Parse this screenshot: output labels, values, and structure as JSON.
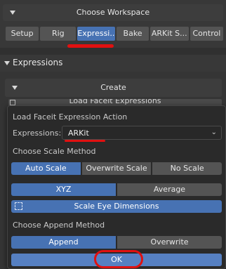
{
  "workspace": {
    "title": "Choose Workspace",
    "tabs": [
      {
        "label": "Setup",
        "active": false
      },
      {
        "label": "Rig",
        "active": false
      },
      {
        "label": "Expressi...",
        "active": true
      },
      {
        "label": "Bake",
        "active": false
      },
      {
        "label": "ARKit S...",
        "active": false
      },
      {
        "label": "Control",
        "active": false
      }
    ]
  },
  "expressions_panel": {
    "title": "Expressions",
    "create_title": "Create",
    "behind_button": "Load Faceit Expressions"
  },
  "popup": {
    "title": "Load Faceit Expression Action",
    "expressions_label": "Expressions:",
    "expressions_value": "ARKit",
    "scale_method_label": "Choose Scale Method",
    "scale_options": [
      {
        "label": "Auto Scale",
        "selected": true
      },
      {
        "label": "Overwrite Scale",
        "selected": false
      },
      {
        "label": "No Scale",
        "selected": false
      }
    ],
    "axis_options": [
      {
        "label": "XYZ",
        "selected": true
      },
      {
        "label": "Average",
        "selected": false
      }
    ],
    "scale_eye_button": "Scale Eye Dimensions",
    "append_method_label": "Choose Append Method",
    "append_options": [
      {
        "label": "Append",
        "selected": true
      },
      {
        "label": "Overwrite",
        "selected": false
      }
    ],
    "ok_button": "OK"
  },
  "colors": {
    "accent": "#4772b3",
    "annotation": "#e01010"
  }
}
